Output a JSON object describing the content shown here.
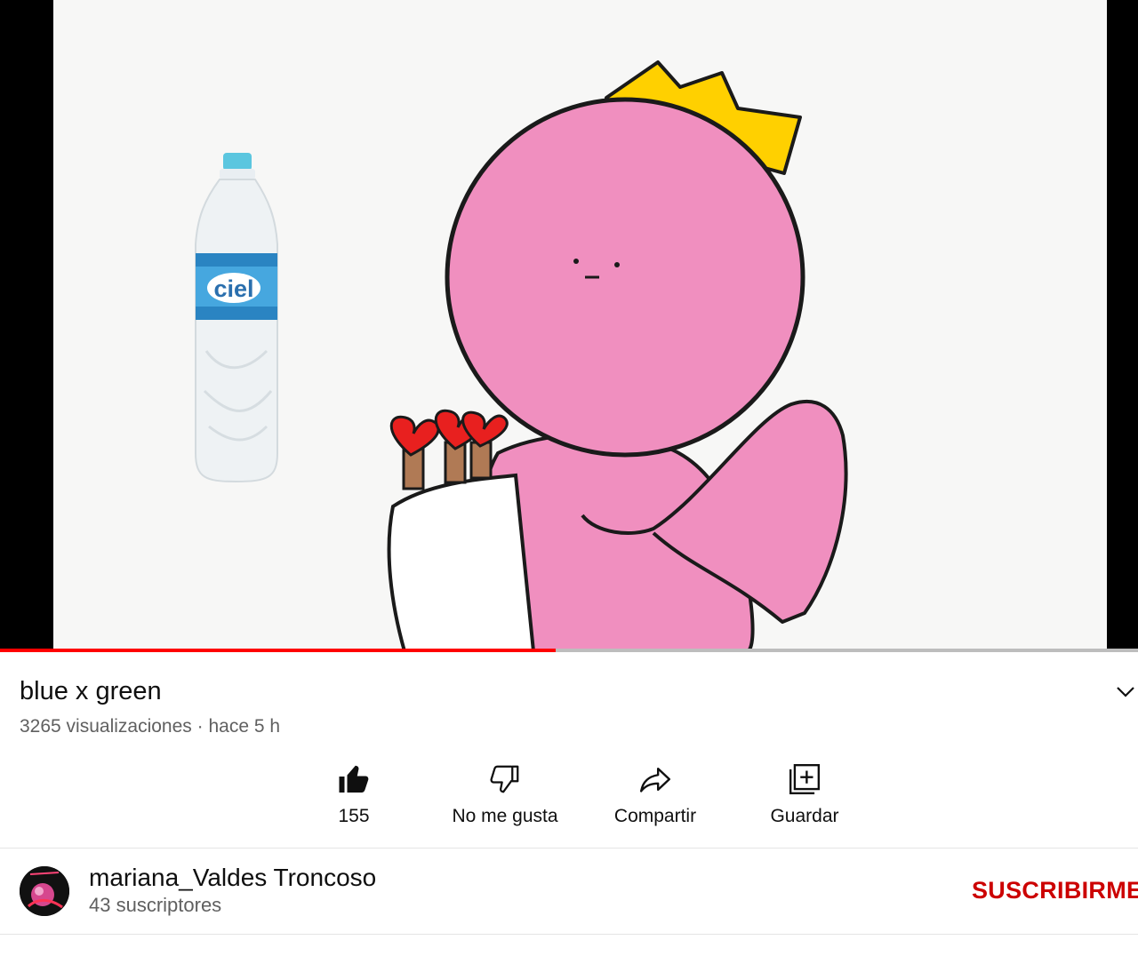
{
  "video": {
    "title": "blue x green",
    "views_label": "3265 visualizaciones",
    "separator": "·",
    "age_label": "hace 5 h",
    "progress_fraction": 0.488,
    "bottle_brand": "ciel"
  },
  "actions": {
    "like_count": "155",
    "dislike_label": "No me gusta",
    "share_label": "Compartir",
    "save_label": "Guardar"
  },
  "channel": {
    "name": "mariana_Valdes Troncoso",
    "subscribers": "43 suscriptores",
    "subscribe_label": "SUSCRIBIRME"
  },
  "colors": {
    "progress": "#ff0000",
    "subscribe": "#cc0000",
    "character_pink": "#f08fbf",
    "crown_yellow": "#ffd000"
  },
  "icons": [
    "like-icon",
    "dislike-icon",
    "share-icon",
    "save-to-playlist-icon",
    "chevron-down-icon"
  ]
}
